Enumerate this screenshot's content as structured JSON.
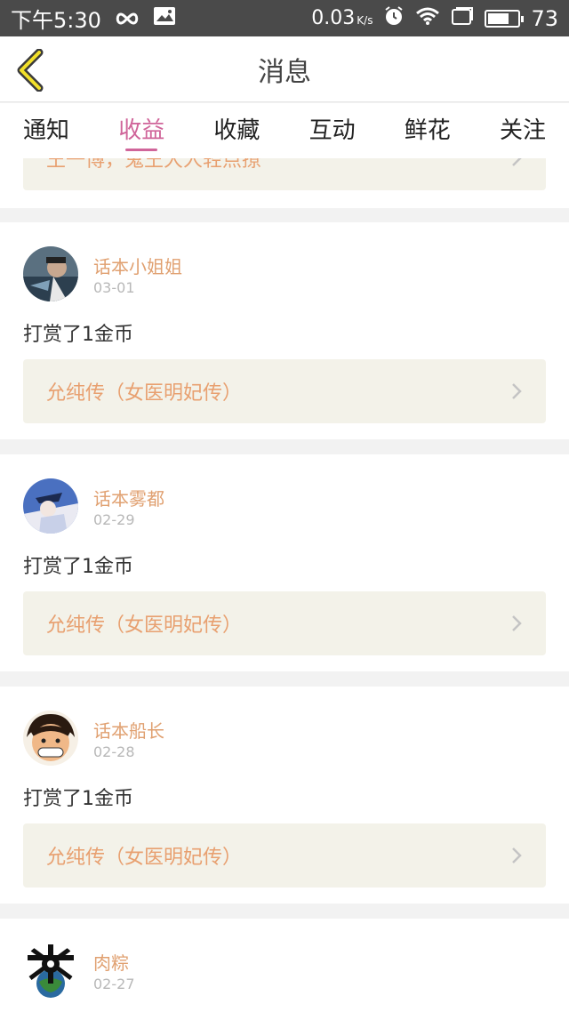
{
  "status_bar": {
    "time": "下午5:30",
    "speed_value": "0.03",
    "speed_unit": "K/s",
    "battery_level": "73",
    "battery_fraction": 0.73
  },
  "header": {
    "title": "消息"
  },
  "tabs": [
    {
      "label": "通知"
    },
    {
      "label": "收益"
    },
    {
      "label": "收藏"
    },
    {
      "label": "互动"
    },
    {
      "label": "鲜花"
    },
    {
      "label": "关注"
    }
  ],
  "active_tab": "收益",
  "partial_top_card": {
    "work_title": "王一博，鬼王大人轻点撩"
  },
  "messages": [
    {
      "user": "话本小姐姐",
      "date": "03-01",
      "action": "打赏了1金币",
      "work_title": "允纯传（女医明妃传）"
    },
    {
      "user": "话本雾都",
      "date": "02-29",
      "action": "打赏了1金币",
      "work_title": "允纯传（女医明妃传）"
    },
    {
      "user": "话本船长",
      "date": "02-28",
      "action": "打赏了1金币",
      "work_title": "允纯传（女医明妃传）"
    },
    {
      "user": "肉粽",
      "date": "02-27"
    }
  ],
  "colors": {
    "accent": "#d0659a",
    "link_text": "#e8a070",
    "name_text": "#e0a070",
    "link_bg": "#f3f2e9"
  },
  "icons": [
    "back-chevron-icon",
    "infinity-icon",
    "gallery-icon",
    "alarm-icon",
    "wifi-icon",
    "recent-apps-icon",
    "battery-icon",
    "chevron-right-icon"
  ]
}
